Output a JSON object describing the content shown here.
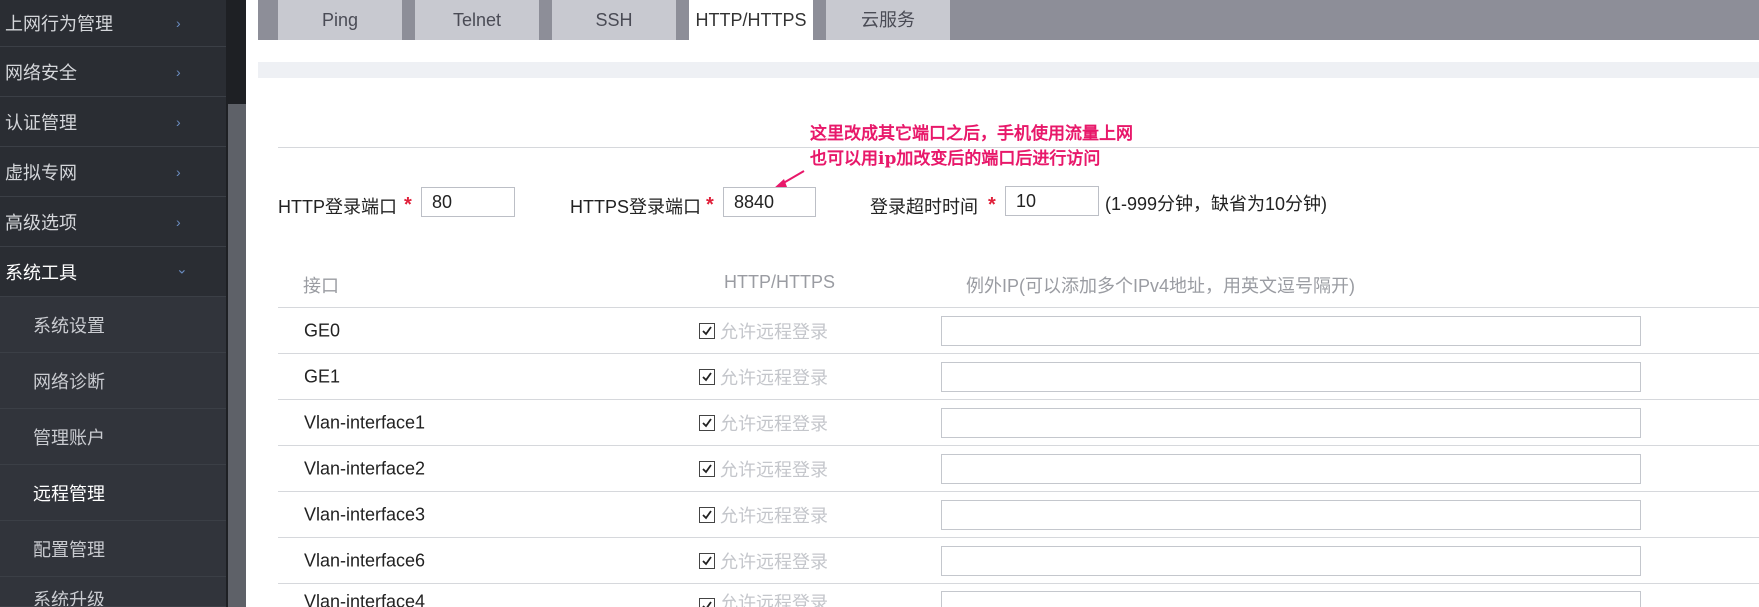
{
  "sidebar": {
    "menu": [
      {
        "label": "上网行为管理"
      },
      {
        "label": "网络安全"
      },
      {
        "label": "认证管理"
      },
      {
        "label": "虚拟专网"
      },
      {
        "label": "高级选项"
      },
      {
        "label": "系统工具"
      }
    ],
    "submenu": [
      {
        "label": "系统设置"
      },
      {
        "label": "网络诊断"
      },
      {
        "label": "管理账户"
      },
      {
        "label": "远程管理"
      },
      {
        "label": "配置管理"
      },
      {
        "label": "系统升级"
      }
    ],
    "chevron_right": "›",
    "chevron_down": "⌄"
  },
  "tabs": [
    {
      "label": "Ping"
    },
    {
      "label": "Telnet"
    },
    {
      "label": "SSH"
    },
    {
      "label": "HTTP/HTTPS"
    },
    {
      "label": "云服务"
    }
  ],
  "annotation": {
    "line1": "这里改成其它端口之后，手机使用流量上网",
    "line2": "也可以用ip加改变后的端口后进行访问"
  },
  "ports": {
    "http_label": "HTTP登录端口",
    "http_value": "80",
    "https_label": "HTTPS登录端口",
    "https_value": "8840",
    "timeout_label": "登录超时时间",
    "timeout_value": "10",
    "timeout_hint": "(1-999分钟，缺省为10分钟)",
    "required_mark": "*"
  },
  "table": {
    "headers": {
      "interface": "接口",
      "protocol": "HTTP/HTTPS",
      "exception": "例外IP(可以添加多个IPv4地址，用英文逗号隔开)"
    },
    "checkbox_label": "允许远程登录",
    "rows": [
      {
        "name": "GE0"
      },
      {
        "name": "GE1"
      },
      {
        "name": "Vlan-interface1"
      },
      {
        "name": "Vlan-interface2"
      },
      {
        "name": "Vlan-interface3"
      },
      {
        "name": "Vlan-interface6"
      },
      {
        "name": "Vlan-interface4"
      }
    ]
  },
  "colors": {
    "sidebar_bg": "#2a2d33",
    "annotation": "#e8186a",
    "required": "#e0203a",
    "tabbar": "#8d8e98"
  }
}
